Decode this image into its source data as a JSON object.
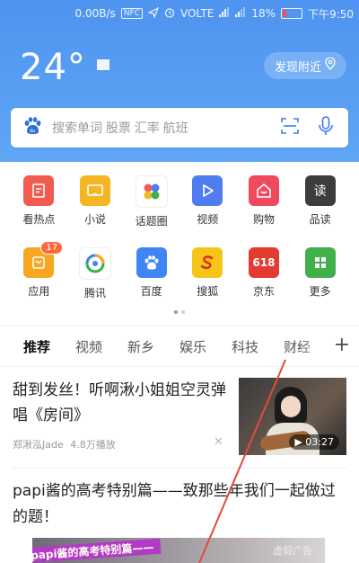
{
  "status_bar": {
    "speed": "0.00B/s",
    "nfc": "NFC",
    "network": "VOLTE",
    "battery": "18%",
    "time": "下午9:50"
  },
  "weather": {
    "temperature": "24°",
    "discover_label": "发现附近"
  },
  "search": {
    "placeholder": "搜索单词 股票 汇率 航班"
  },
  "grid_rows": [
    [
      {
        "label": "看热点",
        "icon": "hot-news-icon",
        "color": "#f25c4f"
      },
      {
        "label": "小说",
        "icon": "novel-icon",
        "color": "#f5b623"
      },
      {
        "label": "话题圈",
        "icon": "topic-circle-icon",
        "color": "#ffffff"
      },
      {
        "label": "视频",
        "icon": "video-play-icon",
        "color": "#4f7cf0"
      },
      {
        "label": "购物",
        "icon": "shopping-icon",
        "color": "#ef4a5e"
      },
      {
        "label": "品读",
        "icon": "reading-icon",
        "color": "#3d3d3d"
      }
    ],
    [
      {
        "label": "应用",
        "icon": "apps-icon",
        "color": "#f6a623",
        "badge": "17"
      },
      {
        "label": "腾讯",
        "icon": "tencent-icon",
        "color": "#33b24d"
      },
      {
        "label": "百度",
        "icon": "baidu-paw-icon",
        "color": "#3f86f4"
      },
      {
        "label": "搜狐",
        "icon": "sohu-icon",
        "color": "#f5c518"
      },
      {
        "label": "京东",
        "icon": "jd-618-icon",
        "color": "#e23b2f",
        "icon_text": "618"
      },
      {
        "label": "更多",
        "icon": "more-grid-icon",
        "color": "#3fb04a"
      }
    ]
  ],
  "tabs": [
    "推荐",
    "视频",
    "新乡",
    "娱乐",
    "科技",
    "财经"
  ],
  "active_tab": "推荐",
  "feed": [
    {
      "title": "甜到发丝！听啊湫小姐姐空灵弹唱《房间》",
      "source": "郑湫泓Jade",
      "plays": "4.8万播放",
      "duration": "03:27"
    },
    {
      "title": "papi酱的高考特别篇——致那些年我们一起做过的题！",
      "preview_banner": "papi酱的高考特别篇——",
      "preview_text": "虚假广告"
    }
  ]
}
